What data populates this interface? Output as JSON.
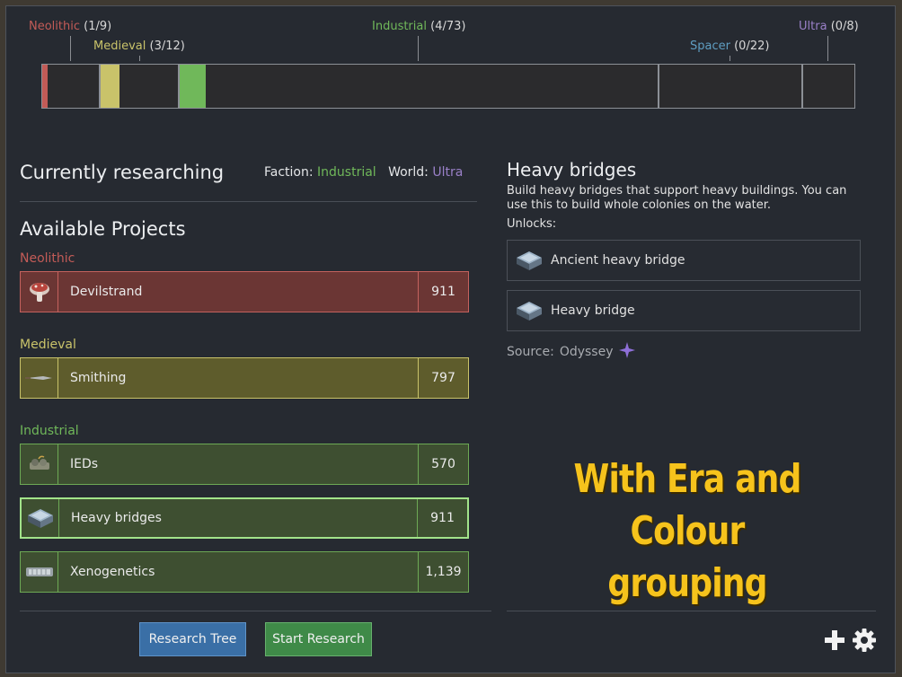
{
  "eras": {
    "neolithic": {
      "name": "Neolithic",
      "count": "(1/9)",
      "color": "#c25b57"
    },
    "medieval": {
      "name": "Medieval",
      "count": "(3/12)",
      "color": "#c9c36a"
    },
    "industrial": {
      "name": "Industrial",
      "count": "(4/73)",
      "color": "#70b85a"
    },
    "spacer": {
      "name": "Spacer",
      "count": "(0/22)",
      "color": "#5f9ec2"
    },
    "ultra": {
      "name": "Ultra",
      "count": "(0/8)",
      "color": "#9a80c8"
    }
  },
  "current": {
    "title": "Currently researching",
    "faction_label": "Faction:",
    "faction_value": "Industrial",
    "world_label": "World:",
    "world_value": "Ultra"
  },
  "available": {
    "title": "Available Projects",
    "groups": [
      {
        "label": "Neolithic",
        "projects": [
          {
            "name": "Devilstrand",
            "cost": "911",
            "icon": "mushroom-icon"
          }
        ]
      },
      {
        "label": "Medieval",
        "projects": [
          {
            "name": "Smithing",
            "cost": "797",
            "icon": "blade-icon"
          }
        ]
      },
      {
        "label": "Industrial",
        "projects": [
          {
            "name": "IEDs",
            "cost": "570",
            "icon": "ied-icon"
          },
          {
            "name": "Heavy bridges",
            "cost": "911",
            "icon": "bridge-icon"
          },
          {
            "name": "Xenogenetics",
            "cost": "1,139",
            "icon": "gene-vat-icon"
          }
        ]
      }
    ]
  },
  "buttons": {
    "research_tree": "Research Tree",
    "start_research": "Start Research"
  },
  "detail": {
    "title": "Heavy bridges",
    "description": "Build heavy bridges that support heavy buildings. You can use this to build whole colonies on the water.",
    "unlocks_label": "Unlocks:",
    "unlocks": [
      {
        "name": "Ancient heavy bridge",
        "icon": "bridge-icon"
      },
      {
        "name": "Heavy bridge",
        "icon": "bridge-icon"
      }
    ],
    "source_label": "Source:",
    "source_value": "Odyssey",
    "source_icon": "odyssey-star-icon"
  },
  "promo": {
    "line1": "With Era and",
    "line2": "Colour grouping"
  },
  "corner_icons": [
    "plus-icon",
    "gear-icon"
  ]
}
